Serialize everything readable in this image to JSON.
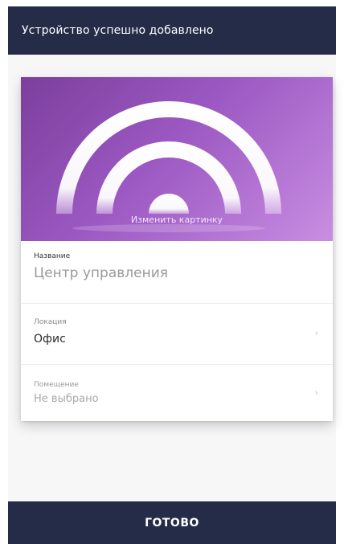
{
  "header": {
    "title": "Устройство успешно добавлено"
  },
  "hero": {
    "change_image_label": "Изменить картинку",
    "gradient_from": "#7c3f9c",
    "gradient_to": "#c98ee2"
  },
  "fields": [
    {
      "label": "Название",
      "value": "Центр управления"
    },
    {
      "label": "Локация",
      "value": "Офис"
    },
    {
      "label": "Помещение",
      "value": "Не выбрано"
    }
  ],
  "footer": {
    "done_label": "ГОТОВО"
  },
  "colors": {
    "bar": "#252c48",
    "accent": "#9b58c2"
  }
}
